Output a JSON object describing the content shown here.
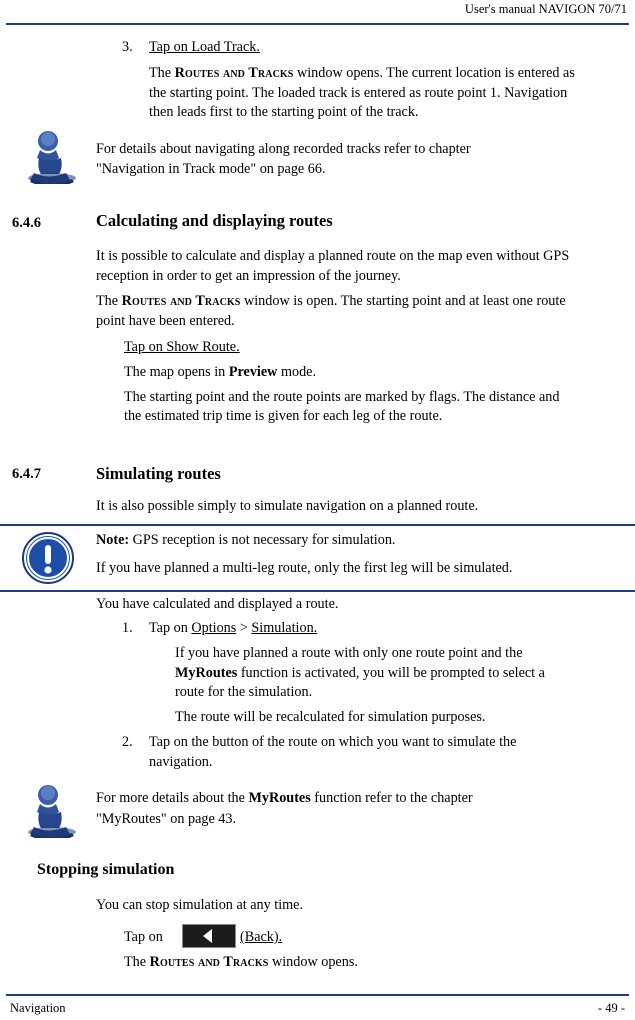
{
  "header": {
    "title": "User's manual NAVIGON 70/71"
  },
  "footer": {
    "left": "Navigation",
    "right": "- 49 -"
  },
  "colors": {
    "rule": "#1d3c8c",
    "note_icon_blue": "#1d4ea8",
    "figure_icon_blue": "#2a4b9b"
  },
  "content": {
    "step3": {
      "number": "3.",
      "label": "Tap on Load Track.",
      "para_pre": "The ",
      "para_sc": "Routes and Tracks",
      "para_post": " window opens. The current location is entered as the starting point. The loaded track is entered as route point 1. Navigation then leads first to the starting point of the track."
    },
    "note_track": {
      "line1": "For details about navigating along recorded tracks refer to chapter",
      "line2": "\"Navigation in Track mode\" on page 66."
    },
    "section_646": {
      "number": "6.4.6",
      "title": "Calculating and displaying routes",
      "p1": "It is possible to calculate and display a planned route on the map even without GPS reception in order to get an impression of the journey.",
      "p2_pre": "The ",
      "p2_sc": "Routes and Tracks",
      "p2_post": " window is open. The starting point and at least one route point have been entered.",
      "step_label": "Tap on Show Route.",
      "step_p1_pre": "The map opens in ",
      "step_p1_b": "Preview",
      "step_p1_post": " mode.",
      "step_p2": "The starting point and the route points are marked by flags. The distance and the estimated trip time is given for each leg of the route."
    },
    "section_647": {
      "number": "6.4.7",
      "title": "Simulating routes",
      "p1": "It is also possible simply to simulate navigation on a planned route.",
      "note": {
        "label": "Note:",
        "text": " GPS reception is not necessary for simulation.",
        "line2": "If you have planned a multi-leg route, only the first leg will be simulated."
      },
      "p2": "You have calculated and displayed a route.",
      "step1": {
        "number": "1.",
        "pre": "Tap on ",
        "link1": "Options",
        "sep": " > ",
        "link2": "Simulation.",
        "sub1_pre": "If you have planned a route with only one route point and the ",
        "sub1_b": "MyRoutes",
        "sub1_post": " function is activated, you will be prompted to select a route for the simulation.",
        "sub2": "The route will be recalculated for simulation purposes."
      },
      "step2": {
        "number": "2.",
        "text": "Tap on the button of the route on which you want to simulate the navigation."
      },
      "note_myroutes": {
        "line1_pre": "For more details about the ",
        "line1_b": "MyRoutes",
        "line1_post": " function refer to the chapter",
        "line2": "\"MyRoutes\" on page 43."
      },
      "stopping": {
        "title": "Stopping simulation",
        "p1": "You can stop simulation at any time.",
        "step_pre": "Tap on",
        "step_button_label": "(Back).",
        "step_post_pre": "The ",
        "step_post_sc": "Routes and Tracks",
        "step_post_end": " window opens."
      }
    }
  },
  "icons": {
    "figure_hint": "chess-pawn-figure-icon",
    "note": "exclamation-circle-icon",
    "back_button": "back-arrow-button-icon"
  }
}
